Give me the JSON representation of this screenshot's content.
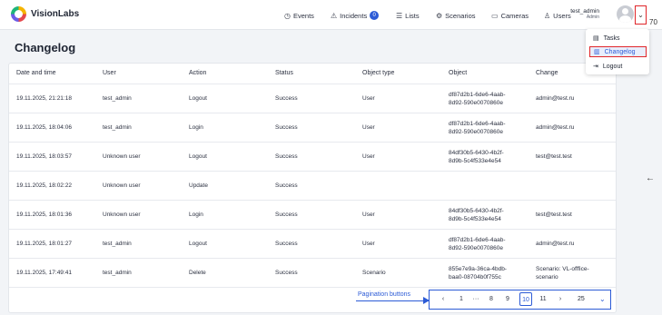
{
  "app": {
    "name": "VisionLabs"
  },
  "nav": [
    {
      "id": "events",
      "label": "Events",
      "icon": "clock-icon"
    },
    {
      "id": "incidents",
      "label": "Incidents",
      "icon": "warning-icon",
      "badge": "0"
    },
    {
      "id": "lists",
      "label": "Lists",
      "icon": "list-icon"
    },
    {
      "id": "scenarios",
      "label": "Scenarios",
      "icon": "sliders-icon"
    },
    {
      "id": "cameras",
      "label": "Cameras",
      "icon": "camera-icon"
    },
    {
      "id": "users",
      "label": "Users",
      "icon": "users-icon"
    }
  ],
  "user": {
    "name": "test_admin",
    "role": "Admin"
  },
  "dropdown_chevron": "⌄",
  "menu": {
    "items": [
      {
        "label": "Tasks",
        "icon": "clipboard-icon"
      },
      {
        "label": "Changelog",
        "icon": "book-icon"
      },
      {
        "label": "Logout",
        "icon": "logout-icon"
      }
    ]
  },
  "side": {
    "number": "70",
    "arrow": "←"
  },
  "page": {
    "title": "Changelog"
  },
  "table": {
    "headers": [
      "Date and time",
      "User",
      "Action",
      "Status",
      "Object type",
      "Object",
      "Change"
    ],
    "rows": [
      {
        "date": "19.11.2025, 21:21:18",
        "user": "test_admin",
        "action": "Logout",
        "status": "Success",
        "type": "User",
        "object": [
          "df87d2b1-6de6-4aab-",
          "8d92-590e0070860e"
        ],
        "change": [
          "admin@test.ru"
        ]
      },
      {
        "date": "19.11.2025, 18:04:06",
        "user": "test_admin",
        "action": "Login",
        "status": "Success",
        "type": "User",
        "object": [
          "df87d2b1-6de6-4aab-",
          "8d92-590e0070860e"
        ],
        "change": [
          "admin@test.ru"
        ]
      },
      {
        "date": "19.11.2025, 18:03:57",
        "user": "Unknown user",
        "action": "Logout",
        "status": "Success",
        "type": "User",
        "object": [
          "84df30b5-6430-4b2f-",
          "8d9b-5c4f533e4e54"
        ],
        "change": [
          "test@test.test"
        ]
      },
      {
        "date": "19.11.2025, 18:02:22",
        "user": "Unknown user",
        "action": "Update",
        "status": "Success",
        "type": "",
        "object": [
          ""
        ],
        "change": [
          ""
        ]
      },
      {
        "date": "19.11.2025, 18:01:36",
        "user": "Unknown user",
        "action": "Login",
        "status": "Success",
        "type": "User",
        "object": [
          "84df30b5-6430-4b2f-",
          "8d9b-5c4f533e4e54"
        ],
        "change": [
          "test@test.test"
        ]
      },
      {
        "date": "19.11.2025, 18:01:27",
        "user": "test_admin",
        "action": "Logout",
        "status": "Success",
        "type": "User",
        "object": [
          "df87d2b1-6de6-4aab-",
          "8d92-590e0070860e"
        ],
        "change": [
          "admin@test.ru"
        ]
      },
      {
        "date": "19.11.2025, 17:49:41",
        "user": "test_admin",
        "action": "Delete",
        "status": "Success",
        "type": "Scenario",
        "object": [
          "855e7e9a-36ca-4bdb-",
          "baa0-08704b0f755c"
        ],
        "change": [
          "Scenario: VL-offfice-",
          "scenario"
        ]
      }
    ]
  },
  "pagination": {
    "label": "Pagination buttons",
    "prev": "‹",
    "next": "›",
    "pages": [
      "1",
      "···",
      "8",
      "9",
      "10",
      "11"
    ],
    "selected": "10",
    "page_size": "25",
    "size_chevron": "⌄"
  },
  "colors": {
    "accent": "#2c5bd6",
    "highlight": "#e0262a"
  }
}
